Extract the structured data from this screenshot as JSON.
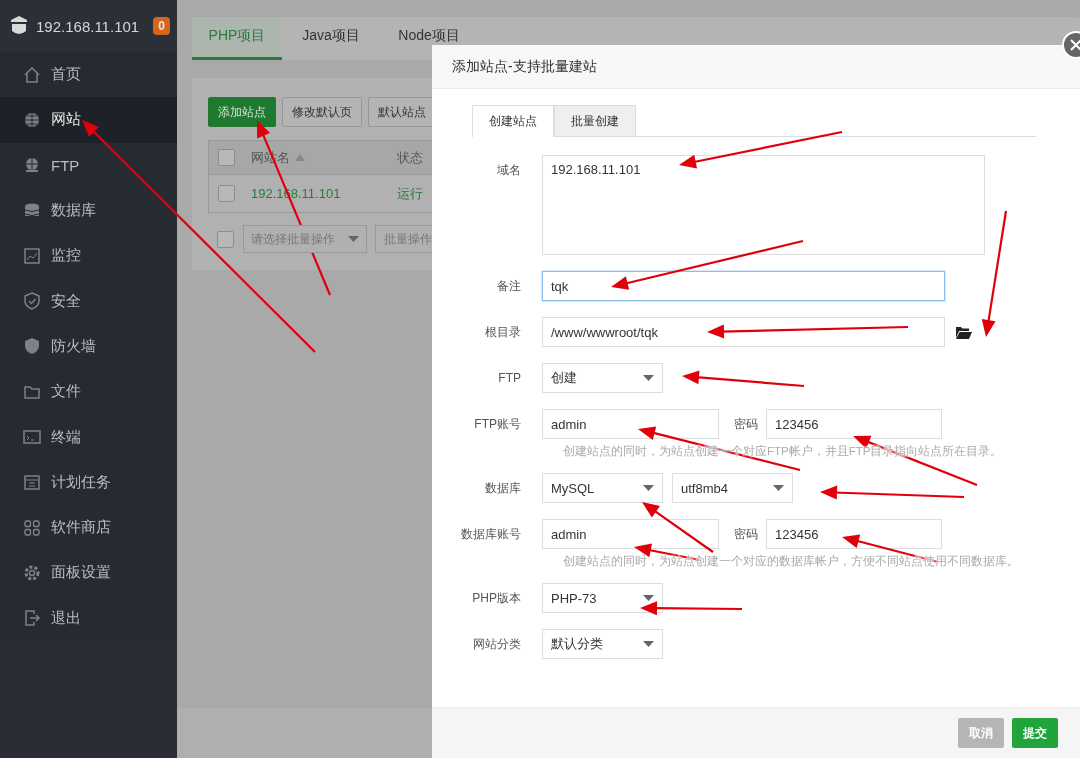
{
  "sidebar": {
    "host": "192.168.11.101",
    "badge": "0",
    "items": [
      {
        "label": "首页",
        "kind": "home",
        "selected": false
      },
      {
        "label": "网站",
        "kind": "globe",
        "selected": true
      },
      {
        "label": "FTP",
        "kind": "ftp",
        "selected": false
      },
      {
        "label": "数据库",
        "kind": "database",
        "selected": false
      },
      {
        "label": "监控",
        "kind": "monitor",
        "selected": false
      },
      {
        "label": "安全",
        "kind": "shield",
        "selected": false
      },
      {
        "label": "防火墙",
        "kind": "firewall",
        "selected": false
      },
      {
        "label": "文件",
        "kind": "folder",
        "selected": false
      },
      {
        "label": "终端",
        "kind": "terminal",
        "selected": false
      },
      {
        "label": "计划任务",
        "kind": "calendar",
        "selected": false
      },
      {
        "label": "软件商店",
        "kind": "apps",
        "selected": false
      },
      {
        "label": "面板设置",
        "kind": "gear",
        "selected": false
      },
      {
        "label": "退出",
        "kind": "logout",
        "selected": false
      }
    ]
  },
  "page": {
    "tabs": [
      {
        "label": "PHP项目",
        "selected": true
      },
      {
        "label": "Java项目",
        "selected": false
      },
      {
        "label": "Node项目",
        "selected": false
      }
    ],
    "toolbar": [
      {
        "label": "添加站点",
        "kind": "primary"
      },
      {
        "label": "修改默认页",
        "kind": "plain"
      },
      {
        "label": "默认站点",
        "kind": "plain"
      }
    ],
    "table": {
      "header_checked": false,
      "columns": [
        "网站名",
        "状态"
      ],
      "rows": [
        {
          "checked": false,
          "cells": [
            "192.168.11.101",
            "运行"
          ]
        }
      ]
    },
    "bulk_checked": false,
    "bulk_select": "请选择批量操作",
    "bulk_button": "批量操作"
  },
  "dialog": {
    "title": "添加站点-支持批量建站",
    "tabs": [
      {
        "label": "创建站点",
        "selected": true
      },
      {
        "label": "批量创建",
        "selected": false
      }
    ],
    "fields": [
      {
        "kind": "textarea",
        "label": "域名",
        "value": "192.168.11.101",
        "focused": false
      },
      {
        "kind": "input",
        "label": "备注",
        "value": "tqk",
        "focused": true
      },
      {
        "kind": "path",
        "label": "根目录",
        "value": "/www/wwwroot/tqk",
        "focused": false
      },
      {
        "kind": "select",
        "label": "FTP",
        "options": [
          "创建"
        ]
      },
      {
        "kind": "account",
        "label": "FTP账号",
        "value": "admin",
        "password_label": "密码",
        "password": "123456"
      },
      {
        "kind": "hint",
        "text": "创建站点的同时，为站点创建一个对应FTP帐户，并且FTP目录指向站点所在目录。"
      },
      {
        "kind": "select",
        "label": "数据库",
        "options": [
          "MySQL",
          "utf8mb4"
        ]
      },
      {
        "kind": "account",
        "label": "数据库账号",
        "value": "admin",
        "password_label": "密码",
        "password": "123456"
      },
      {
        "kind": "hint",
        "text": "创建站点的同时，为站点创建一个对应的数据库帐户，方便不同站点使用不同数据库。"
      },
      {
        "kind": "select",
        "label": "PHP版本",
        "options": [
          "PHP-73"
        ]
      },
      {
        "kind": "select",
        "label": "网站分类",
        "options": [
          "默认分类"
        ]
      }
    ],
    "buttons": [
      {
        "label": "取消",
        "disabled": true
      },
      {
        "label": "提交",
        "disabled": false
      }
    ]
  }
}
